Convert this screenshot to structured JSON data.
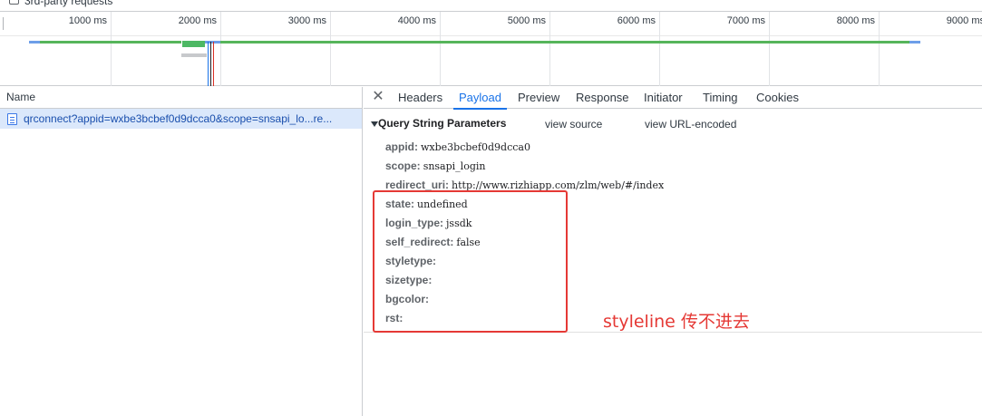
{
  "filter": {
    "third_party_label": "3rd-party requests"
  },
  "overview": {
    "ticks": [
      "1000 ms",
      "2000 ms",
      "3000 ms",
      "4000 ms",
      "5000 ms",
      "6000 ms",
      "7000 ms",
      "8000 ms",
      "9000 ms"
    ],
    "colors": {
      "green": "#56b55b",
      "blue": "#6d9ee8",
      "red_marker": "#d93025",
      "blue_marker": "#1a73e8"
    }
  },
  "requests": {
    "header": "Name",
    "rows": [
      {
        "name": "qrconnect?appid=wxbe3bcbef0d9dcca0&scope=snsapi_lo...re..."
      }
    ]
  },
  "detail": {
    "close_icon": "close-icon",
    "tabs": [
      "Headers",
      "Payload",
      "Preview",
      "Response",
      "Initiator",
      "Timing",
      "Cookies"
    ],
    "active_tab": "Payload",
    "section_title": "Query String Parameters",
    "view_source": "view source",
    "view_url_encoded": "view URL-encoded",
    "params": [
      {
        "key": "appid:",
        "value": "wxbe3bcbef0d9dcca0"
      },
      {
        "key": "scope:",
        "value": "snsapi_login"
      },
      {
        "key": "redirect_uri:",
        "value": "http://www.rizhiapp.com/zlm/web/#/index"
      },
      {
        "key": "state:",
        "value": "undefined"
      },
      {
        "key": "login_type:",
        "value": "jssdk"
      },
      {
        "key": "self_redirect:",
        "value": "false"
      },
      {
        "key": "styletype:",
        "value": ""
      },
      {
        "key": "sizetype:",
        "value": ""
      },
      {
        "key": "bgcolor:",
        "value": ""
      },
      {
        "key": "rst:",
        "value": ""
      }
    ]
  },
  "annotation": {
    "text": "styleline  传不进去",
    "color": "#e53935"
  }
}
